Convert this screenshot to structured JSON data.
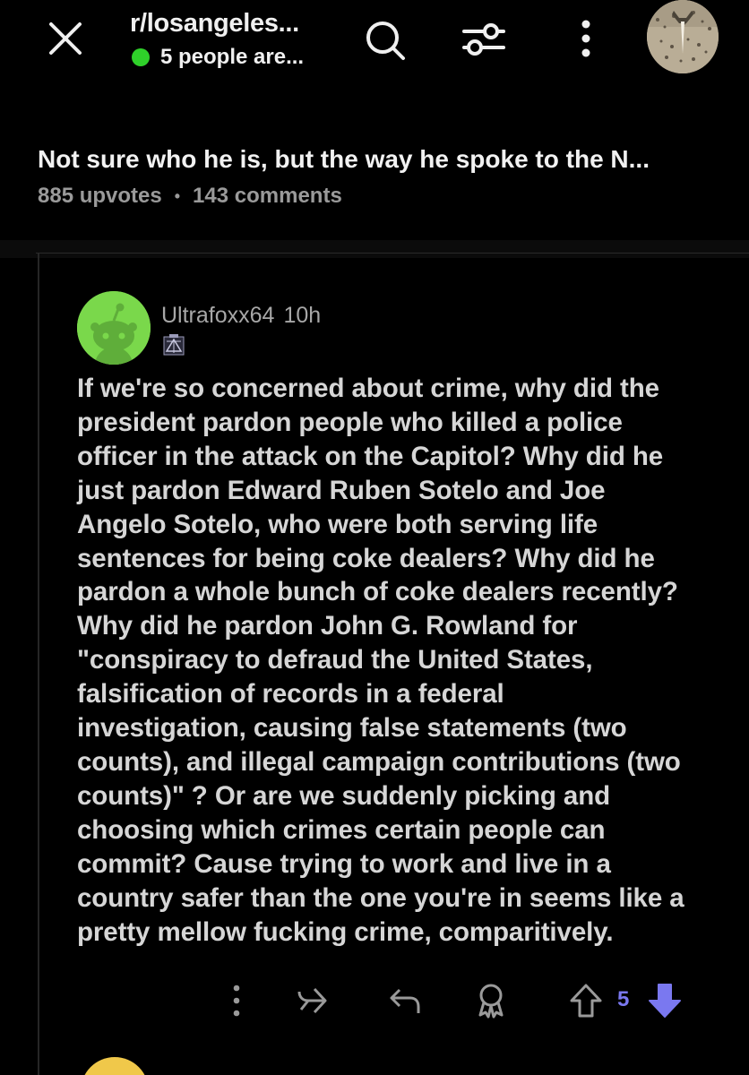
{
  "header": {
    "subreddit": "r/losangeles...",
    "online_text": "5 people are...",
    "online_color": "#2fd12a"
  },
  "post": {
    "title": "Not sure who he is, but the way he spoke to the N...",
    "upvotes": "885 upvotes",
    "separator": "•",
    "comments": "143 comments"
  },
  "comment": {
    "username": "Ultrafoxx64",
    "age": "10h",
    "lines": [
      "If we're so concerned about crime, why did the",
      "president pardon people who killed a police",
      "officer in the attack on the Capitol? Why did he",
      "just pardon Edward Ruben Sotelo and Joe",
      "Angelo Sotelo, who were both serving life",
      "sentences for being coke dealers? Why did he",
      "pardon a whole bunch of coke dealers recently?",
      "Why did he pardon John G. Rowland for",
      "\"conspiracy to defraud the United States,",
      "falsification of records in a federal",
      "investigation, causing false statements (two",
      "counts), and illegal campaign contributions (two",
      "counts)\" ? Or are we suddenly picking and",
      "choosing which crimes certain people can",
      "commit? Cause trying to work and live in a",
      "country safer than the one you're in seems like a",
      "pretty mellow fucking crime, comparitively."
    ],
    "vote_count": "5",
    "downvote_color": "#7a78f0"
  },
  "icons": {
    "close": "close-icon",
    "search": "search-icon",
    "filter": "filter-icon",
    "more": "more-vertical-icon",
    "share": "share-icon",
    "reply": "reply-icon",
    "award": "award-icon",
    "upvote": "upvote-icon",
    "downvote": "downvote-icon"
  }
}
